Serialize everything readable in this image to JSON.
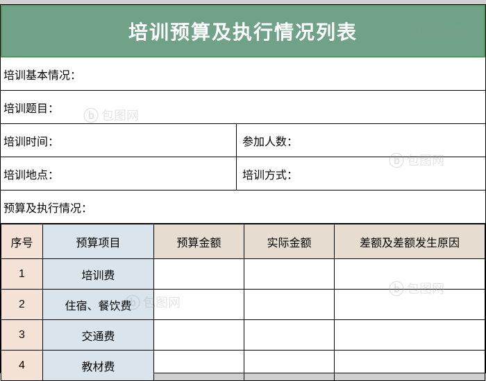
{
  "title": "培训预算及执行情况列表",
  "info": {
    "basic_label": "培训基本情况：",
    "topic_label": "培训题目：",
    "time_label": "培训时间：",
    "participants_label": "参加人数：",
    "location_label": "培训地点：",
    "method_label": "培训方式：",
    "budget_exec_label": "预算及执行情况："
  },
  "table": {
    "headers": {
      "no": "序号",
      "item": "预算项目",
      "budget": "预算金额",
      "actual": "实际金额",
      "diff": "差额及差额发生原因"
    },
    "rows": [
      {
        "no": "1",
        "item": "培训费",
        "budget": "",
        "actual": "",
        "diff": ""
      },
      {
        "no": "2",
        "item": "住宿、餐饮费",
        "budget": "",
        "actual": "",
        "diff": ""
      },
      {
        "no": "3",
        "item": "交通费",
        "budget": "",
        "actual": "",
        "diff": ""
      },
      {
        "no": "4",
        "item": "教材费",
        "budget": "",
        "actual": "",
        "diff": ""
      }
    ]
  },
  "watermark_text": "包图网"
}
